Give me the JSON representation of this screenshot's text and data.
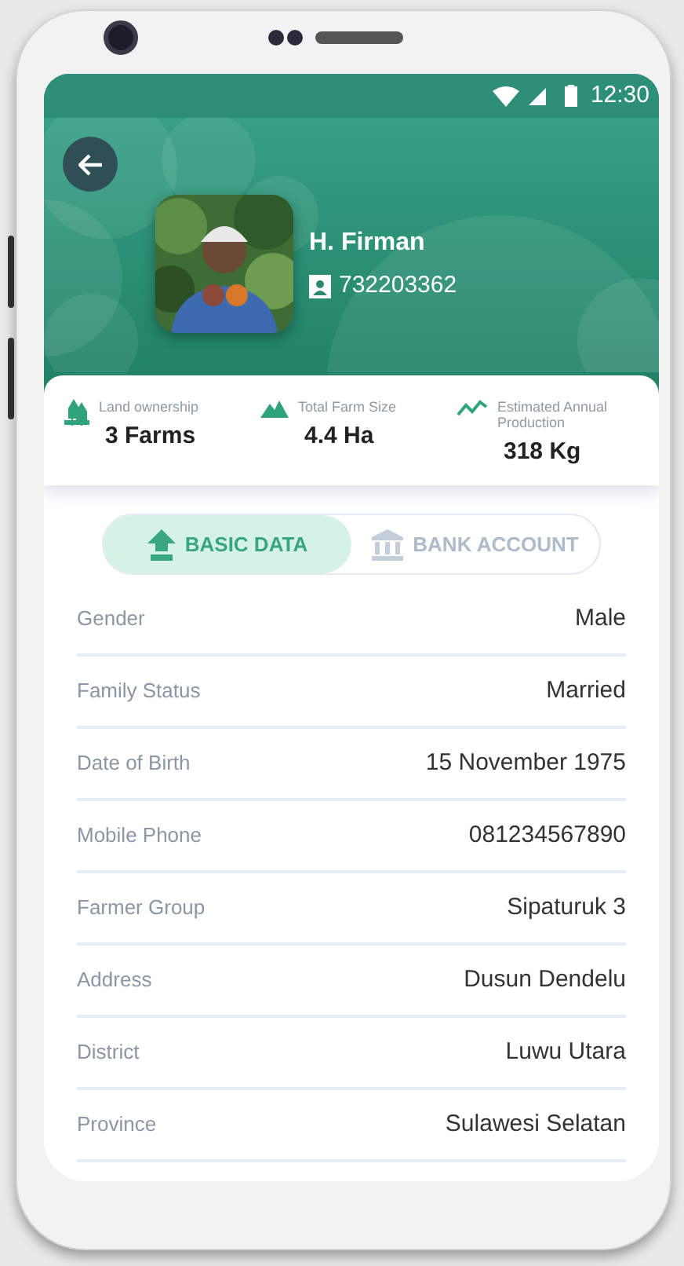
{
  "status_bar": {
    "time": "12:30"
  },
  "profile": {
    "name": "H. Firman",
    "id_number": "732203362"
  },
  "stats": [
    {
      "kind": "land",
      "label": "Land ownership",
      "value": "3 Farms"
    },
    {
      "kind": "size",
      "label": "Total Farm Size",
      "value": "4.4 Ha"
    },
    {
      "kind": "production",
      "label": "Estimated Annual Production",
      "value": "318 Kg"
    }
  ],
  "tabs": [
    {
      "kind": "basic",
      "label": "BASIC DATA",
      "selected": true
    },
    {
      "kind": "bank",
      "label": "BANK ACCOUNT",
      "selected": false
    }
  ],
  "fields": [
    {
      "label": "Gender",
      "value": "Male"
    },
    {
      "label": "Family Status",
      "value": "Married"
    },
    {
      "label": "Date of Birth",
      "value": "15 November 1975"
    },
    {
      "label": "Mobile Phone",
      "value": "081234567890"
    },
    {
      "label": "Farmer Group",
      "value": "Sipaturuk 3"
    },
    {
      "label": "Address",
      "value": "Dusun Dendelu"
    },
    {
      "label": "District",
      "value": "Luwu Utara"
    },
    {
      "label": "Province",
      "value": "Sulawesi Selatan"
    }
  ]
}
